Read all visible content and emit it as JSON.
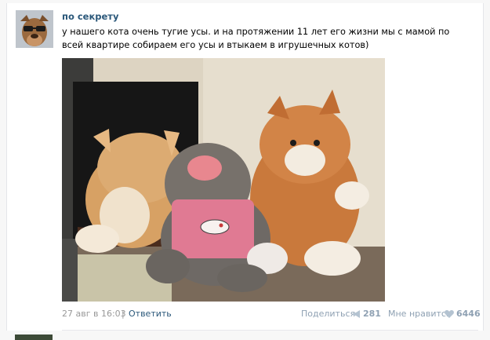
{
  "post": {
    "author": "по секрету",
    "text": "у нашего кота очень тугие усы. и на протяжении 11 лет его жизни мы с мамой по всей квартире собираем его усы и втыкаем в игрушечных котов)",
    "date": "27 авг в 16:03",
    "separator": "|",
    "reply_label": "Ответить",
    "share_label": "Поделиться",
    "share_count": "281",
    "like_label": "Мне нравится",
    "like_count": "6446"
  },
  "icons": {
    "share": "megaphone-icon",
    "like": "heart-icon"
  },
  "colors": {
    "link": "#2b587a",
    "muted": "#999999",
    "action": "#8fa1b3"
  }
}
